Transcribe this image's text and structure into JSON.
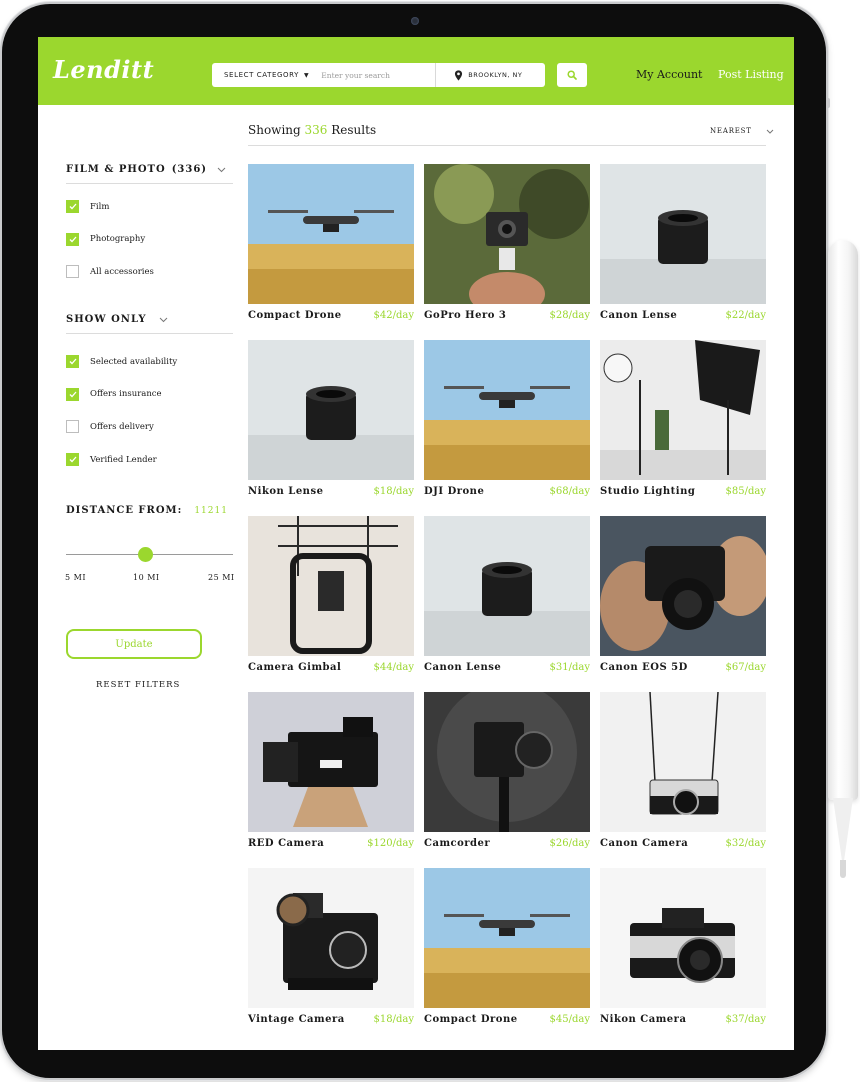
{
  "brand": {
    "accent": "#9bd72e",
    "logo": "Lenditt"
  },
  "header": {
    "category_label": "SELECT CATEGORY",
    "search_placeholder": "Enter your search",
    "location": "BROOKLYN, NY",
    "nav_account": "My Account",
    "nav_post": "Post Listing"
  },
  "filters": {
    "category_heading": "FILM & PHOTO",
    "category_count": "(336)",
    "category_options": [
      {
        "label": "Film",
        "checked": true
      },
      {
        "label": "Photography",
        "checked": true
      },
      {
        "label": "All accessories",
        "checked": false
      }
    ],
    "show_only_heading": "SHOW ONLY",
    "show_only_options": [
      {
        "label": "Selected availability",
        "checked": true
      },
      {
        "label": "Offers insurance",
        "checked": true
      },
      {
        "label": "Offers delivery",
        "checked": false
      },
      {
        "label": "Verified Lender",
        "checked": true
      }
    ],
    "distance_heading": "DISTANCE FROM:",
    "zip": "11211",
    "distance_marks": [
      "5 MI",
      "10 MI",
      "25 MI"
    ],
    "update_label": "Update",
    "reset_label": "RESET FILTERS"
  },
  "results": {
    "showing_prefix": "Showing",
    "count": "336",
    "suffix": "Results",
    "sort_label": "NEAREST"
  },
  "listings": [
    {
      "title": "Compact Drone",
      "price": "$42/day",
      "icon": "drone-photo"
    },
    {
      "title": "GoPro Hero 3",
      "price": "$28/day",
      "icon": "action-camera-photo"
    },
    {
      "title": "Canon Lense",
      "price": "$22/day",
      "icon": "lens-photo"
    },
    {
      "title": "Nikon Lense",
      "price": "$18/day",
      "icon": "lens-photo"
    },
    {
      "title": "DJI Drone",
      "price": "$68/day",
      "icon": "drone-photo"
    },
    {
      "title": "Studio Lighting",
      "price": "$85/day",
      "icon": "studio-lighting-photo"
    },
    {
      "title": "Camera Gimbal",
      "price": "$44/day",
      "icon": "gimbal-photo"
    },
    {
      "title": "Canon Lense",
      "price": "$31/day",
      "icon": "lens-photo"
    },
    {
      "title": "Canon EOS 5D",
      "price": "$67/day",
      "icon": "dslr-photo"
    },
    {
      "title": "RED Camera",
      "price": "$120/day",
      "icon": "cinema-camera-photo"
    },
    {
      "title": "Camcorder",
      "price": "$26/day",
      "icon": "camcorder-photo"
    },
    {
      "title": "Canon Camera",
      "price": "$32/day",
      "icon": "rangefinder-camera-photo"
    },
    {
      "title": "Vintage Camera",
      "price": "$18/day",
      "icon": "vintage-camera-photo"
    },
    {
      "title": "Compact Drone",
      "price": "$45/day",
      "icon": "drone-photo"
    },
    {
      "title": "Nikon Camera",
      "price": "$37/day",
      "icon": "slr-camera-photo"
    }
  ]
}
